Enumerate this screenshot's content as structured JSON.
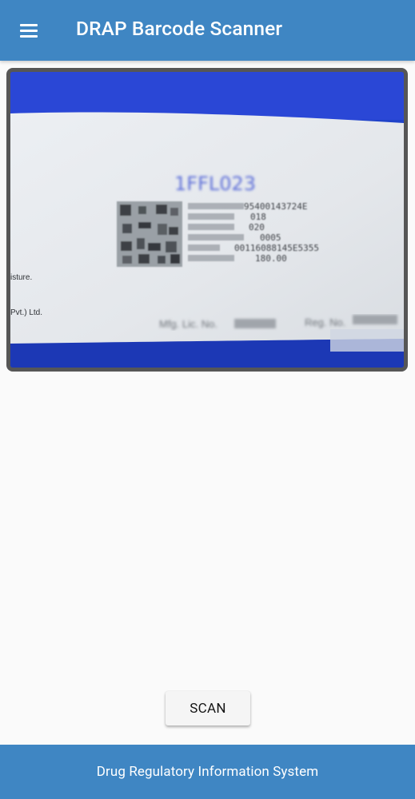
{
  "app_bar": {
    "title": "DRAP Barcode Scanner",
    "menu_icon": "hamburger-menu-icon"
  },
  "camera_preview": {
    "label_text_top_code": "1FFL023",
    "label_lines": [
      "95400143724E",
      "018",
      "020",
      "0005",
      "00116088145E5355",
      "180.00"
    ],
    "left_text_1": "isture.",
    "left_text_2": "Pvt.) Ltd.",
    "bottom_text_1": "Mfg. Lic. No.",
    "bottom_text_2": "Reg. No."
  },
  "scan_button": {
    "label": "SCAN"
  },
  "footer": {
    "text": "Drug Regulatory Information System"
  },
  "colors": {
    "primary": "#3f86c3",
    "background": "#fafafa",
    "frame_border": "#565656"
  }
}
